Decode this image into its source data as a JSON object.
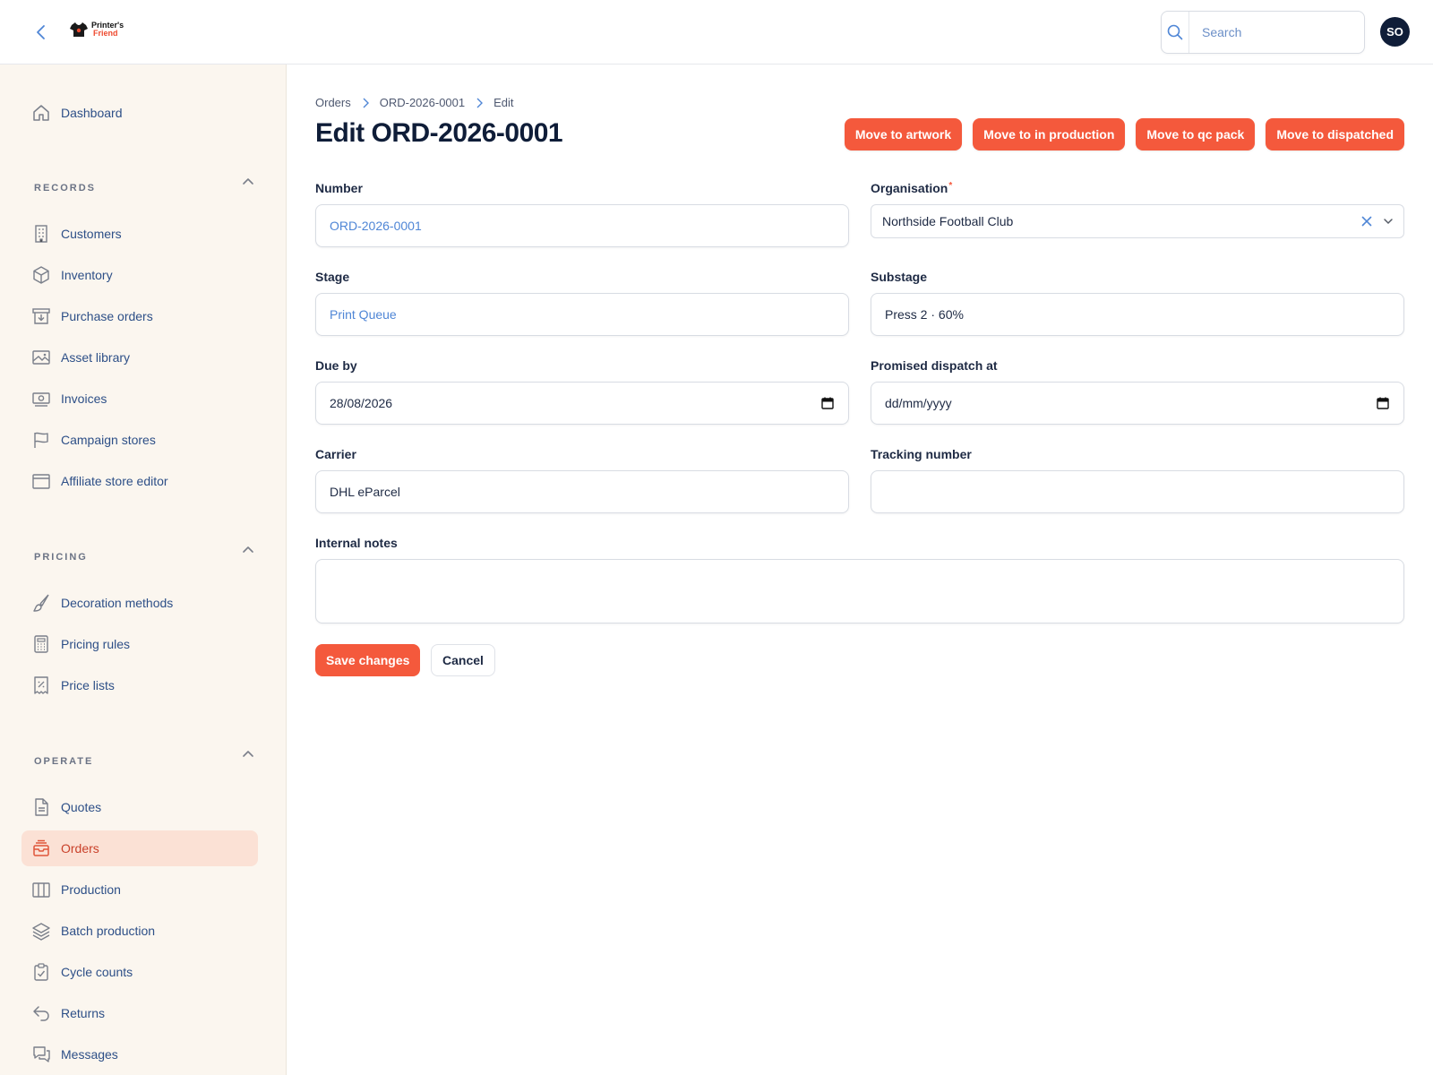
{
  "header": {
    "logo_line1": "Printer's",
    "logo_line2": "Friend",
    "search_placeholder": "Search",
    "avatar_initials": "SO"
  },
  "sidebar": {
    "dashboard": "Dashboard",
    "records_title": "RECORDS",
    "records": [
      "Customers",
      "Inventory",
      "Purchase orders",
      "Asset library",
      "Invoices",
      "Campaign stores",
      "Affiliate store editor"
    ],
    "pricing_title": "PRICING",
    "pricing": [
      "Decoration methods",
      "Pricing rules",
      "Price lists"
    ],
    "operate_title": "OPERATE",
    "operate": [
      "Quotes",
      "Orders",
      "Production",
      "Batch production",
      "Cycle counts",
      "Returns",
      "Messages"
    ],
    "active_item": "Orders"
  },
  "breadcrumb": [
    "Orders",
    "ORD-2026-0001",
    "Edit"
  ],
  "page_title": "Edit ORD-2026-0001",
  "actions": [
    "Move to artwork",
    "Move to in production",
    "Move to qc pack",
    "Move to dispatched"
  ],
  "form": {
    "number_label": "Number",
    "number_value": "ORD-2026-0001",
    "organisation_label": "Organisation",
    "organisation_required": "*",
    "organisation_value": "Northside Football Club",
    "stage_label": "Stage",
    "stage_value": "Print Queue",
    "substage_label": "Substage",
    "substage_value": "Press 2 · 60%",
    "due_by_label": "Due by",
    "due_by_value": "28/08/2026",
    "promised_label": "Promised dispatch at",
    "promised_placeholder": "dd/mm/yyyy",
    "carrier_label": "Carrier",
    "carrier_value": "DHL eParcel",
    "tracking_label": "Tracking number",
    "tracking_value": "",
    "notes_label": "Internal notes",
    "notes_value": ""
  },
  "buttons": {
    "save": "Save changes",
    "cancel": "Cancel"
  },
  "colors": {
    "accent": "#f4593c",
    "sidebar_bg": "#fbf6ef",
    "active_bg": "#fbe1d5",
    "nav_text": "#2d4f87",
    "title": "#0f1d38"
  }
}
